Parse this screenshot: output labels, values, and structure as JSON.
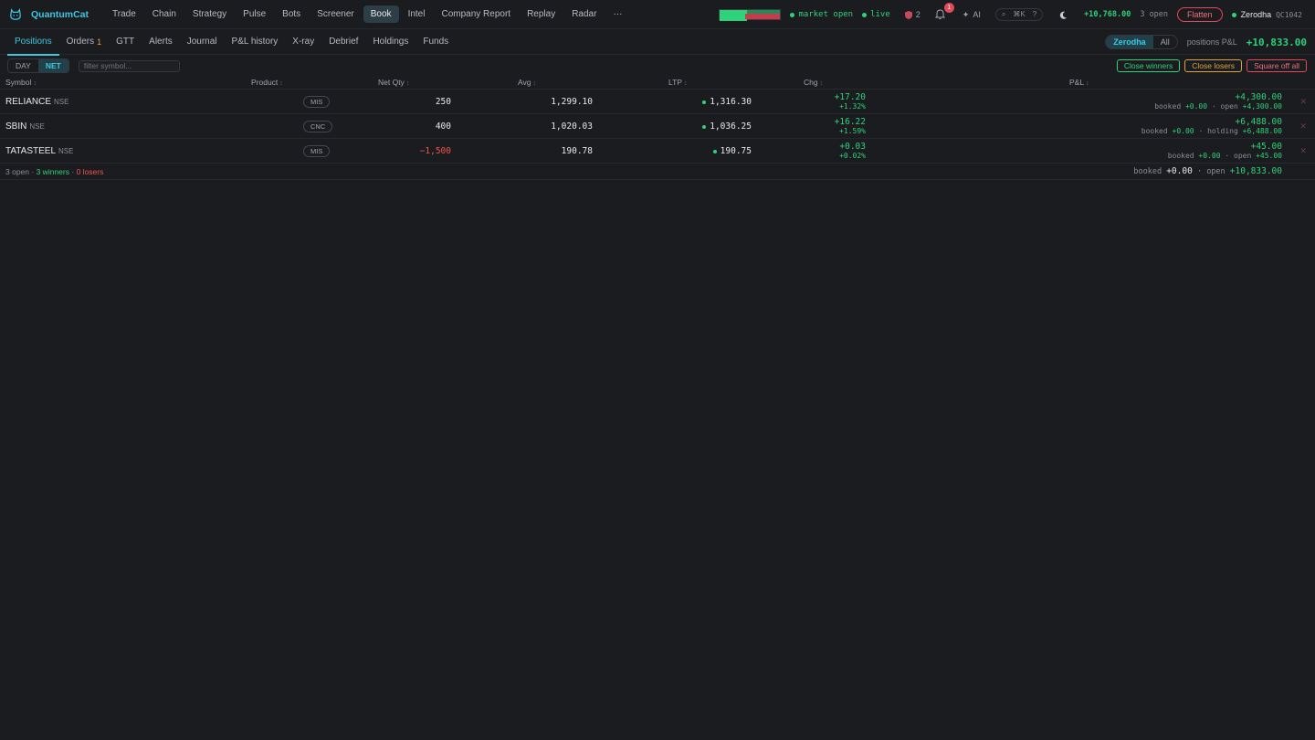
{
  "app": {
    "name": "QuantumCat"
  },
  "nav": [
    {
      "label": "Trade"
    },
    {
      "label": "Chain"
    },
    {
      "label": "Strategy"
    },
    {
      "label": "Pulse"
    },
    {
      "label": "Bots"
    },
    {
      "label": "Screener"
    },
    {
      "label": "Book",
      "active": true
    },
    {
      "label": "Intel"
    },
    {
      "label": "Company Report"
    },
    {
      "label": "Replay"
    },
    {
      "label": "Radar"
    },
    {
      "label": "···"
    }
  ],
  "topbar": {
    "market_status": "market open",
    "feed_status": "live",
    "shield_count": "2",
    "notifications": "1",
    "ai_label": "AI",
    "shortcut": "⌘K",
    "help": "?",
    "day_pnl": "+10,768.00",
    "open_count": "3 open",
    "flatten_label": "Flatten",
    "broker": "Zerodha",
    "client_id": "QC1042"
  },
  "subtabs": [
    {
      "label": "Positions",
      "active": true
    },
    {
      "label": "Orders",
      "count": "1"
    },
    {
      "label": "GTT"
    },
    {
      "label": "Alerts"
    },
    {
      "label": "Journal"
    },
    {
      "label": "P&L history"
    },
    {
      "label": "X-ray"
    },
    {
      "label": "Debrief"
    },
    {
      "label": "Holdings"
    },
    {
      "label": "Funds"
    }
  ],
  "scope": {
    "options": [
      "Zerodha",
      "All"
    ],
    "selected": "Zerodha"
  },
  "positions_pnl": {
    "label": "positions P&L",
    "value": "+10,833.00"
  },
  "toolbar": {
    "modes": [
      "DAY",
      "NET"
    ],
    "selected_mode": "NET",
    "filter_placeholder": "filter symbol...",
    "close_winners": "Close winners",
    "close_losers": "Close losers",
    "square_off_all": "Square off all"
  },
  "columns": {
    "symbol": "Symbol",
    "product": "Product",
    "net_qty": "Net Qty",
    "avg": "Avg",
    "ltp": "LTP",
    "chg": "Chg",
    "pnl": "P&L"
  },
  "rows": [
    {
      "symbol": "RELIANCE",
      "exchange": "NSE",
      "product": "MIS",
      "qty": "250",
      "qty_neg": false,
      "avg": "1,299.10",
      "ltp": "1,316.30",
      "chg": "+17.20",
      "chg_pct": "+1.32%",
      "pnl": "+4,300.00",
      "booked": "+0.00",
      "state_label": "open",
      "state_value": "+4,300.00"
    },
    {
      "symbol": "SBIN",
      "exchange": "NSE",
      "product": "CNC",
      "qty": "400",
      "qty_neg": false,
      "avg": "1,020.03",
      "ltp": "1,036.25",
      "chg": "+16.22",
      "chg_pct": "+1.59%",
      "pnl": "+6,488.00",
      "booked": "+0.00",
      "state_label": "holding",
      "state_value": "+6,488.00"
    },
    {
      "symbol": "TATASTEEL",
      "exchange": "NSE",
      "product": "MIS",
      "qty": "−1,500",
      "qty_neg": true,
      "avg": "190.78",
      "ltp": "190.75",
      "chg": "+0.03",
      "chg_pct": "+0.02%",
      "pnl": "+45.00",
      "booked": "+0.00",
      "state_label": "open",
      "state_value": "+45.00"
    }
  ],
  "footer": {
    "open": "3 open",
    "winners": "3 winners",
    "losers": "0 losers",
    "booked_label": "booked",
    "booked": "+0.00",
    "open_label": "open",
    "open_value": "+10,833.00"
  },
  "labels": {
    "booked": "booked",
    "sep": "·"
  },
  "colors": {
    "accent": "#3ec7e0",
    "profit": "#2fd17b",
    "loss": "#ef5350",
    "warn": "#e0a33c",
    "bg": "#1b1c1f"
  }
}
